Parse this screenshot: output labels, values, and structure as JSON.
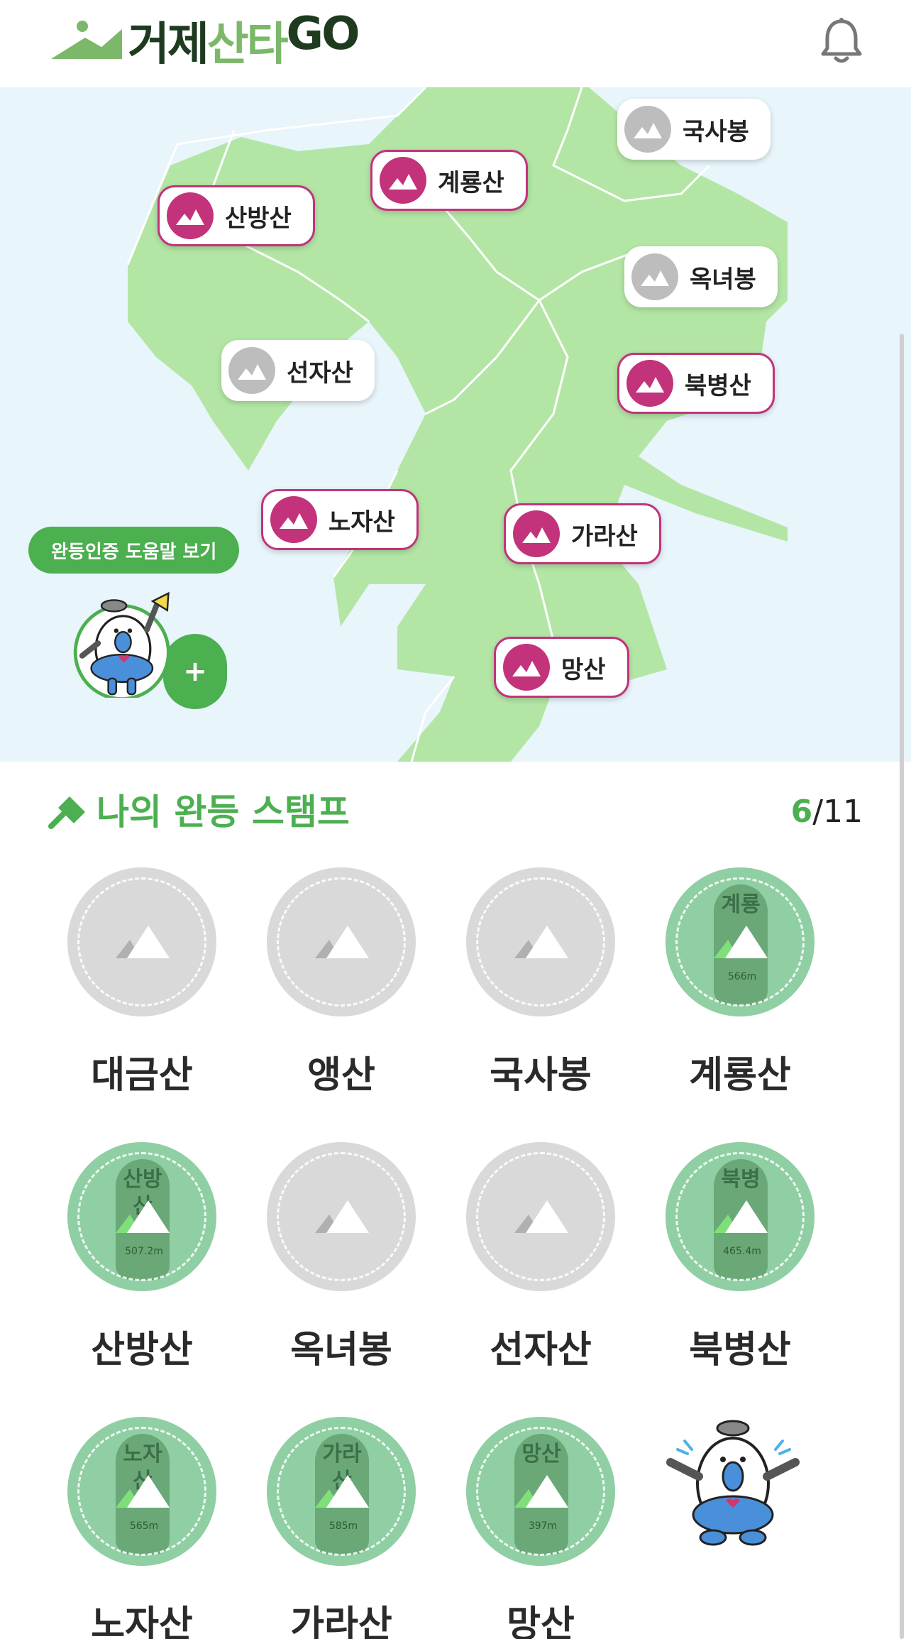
{
  "app": {
    "logo_dark": "거제",
    "logo_green": "산타",
    "logo_dark2": "GO"
  },
  "colors": {
    "brand_green": "#4caf50",
    "done_pink": "#c2337c",
    "todo_gray": "#bdbdbd",
    "land": "#b3e6a5",
    "sea": "#e8f5fb"
  },
  "map": {
    "pins": [
      {
        "label": "국사봉",
        "status": "todo"
      },
      {
        "label": "계룡산",
        "status": "done"
      },
      {
        "label": "산방산",
        "status": "done"
      },
      {
        "label": "옥녀봉",
        "status": "todo"
      },
      {
        "label": "선자산",
        "status": "todo"
      },
      {
        "label": "북병산",
        "status": "done"
      },
      {
        "label": "노자산",
        "status": "done"
      },
      {
        "label": "가라산",
        "status": "done"
      },
      {
        "label": "망산",
        "status": "done"
      }
    ],
    "help_label": "완등인증 도움말 보기",
    "plus_label": "+"
  },
  "stamps": {
    "title": "나의 완등 스탬프",
    "count_done": "6",
    "count_total": "/11",
    "items": [
      {
        "name": "대금산",
        "status": "todo",
        "rock_text": "",
        "height": ""
      },
      {
        "name": "앵산",
        "status": "todo",
        "rock_text": "",
        "height": ""
      },
      {
        "name": "국사봉",
        "status": "todo",
        "rock_text": "",
        "height": ""
      },
      {
        "name": "계룡산",
        "status": "done",
        "rock_text": "계룡",
        "height": "566m"
      },
      {
        "name": "산방산",
        "status": "done",
        "rock_text": "산방산",
        "height": "507.2m"
      },
      {
        "name": "옥녀봉",
        "status": "todo",
        "rock_text": "",
        "height": ""
      },
      {
        "name": "선자산",
        "status": "todo",
        "rock_text": "",
        "height": ""
      },
      {
        "name": "북병산",
        "status": "done",
        "rock_text": "북병",
        "height": "465.4m"
      },
      {
        "name": "노자산",
        "status": "done",
        "rock_text": "노자산",
        "height": "565m"
      },
      {
        "name": "가라산",
        "status": "done",
        "rock_text": "가라산",
        "height": "585m"
      },
      {
        "name": "망산",
        "status": "done",
        "rock_text": "망산",
        "height": "397m"
      }
    ]
  }
}
